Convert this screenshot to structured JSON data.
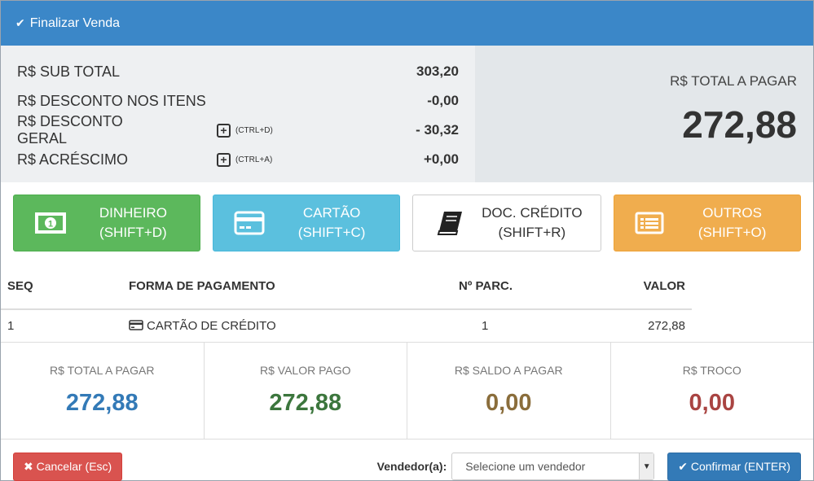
{
  "header": {
    "title": "Finalizar Venda"
  },
  "totals": {
    "rows": [
      {
        "label": "R$ SUB TOTAL",
        "value": "303,20"
      },
      {
        "label": "R$ DESCONTO NOS ITENS",
        "value": "-0,00"
      },
      {
        "label": "R$ DESCONTO GERAL",
        "shortcut": "(CTRL+D)",
        "value": "- 30,32"
      },
      {
        "label": "R$ ACRÉSCIMO",
        "shortcut": "(CTRL+A)",
        "value": "+0,00"
      }
    ],
    "total_label": "R$ TOTAL A PAGAR",
    "total_value": "272,88"
  },
  "payment_buttons": [
    {
      "label": "DINHEIRO",
      "shortcut": "(SHIFT+D)",
      "icon": "money-icon",
      "color": "#5cb85c"
    },
    {
      "label": "CARTÃO",
      "shortcut": "(SHIFT+C)",
      "icon": "credit-card-icon",
      "color": "#5bc0de"
    },
    {
      "label": "DOC. CRÉDITO",
      "shortcut": "(SHIFT+R)",
      "icon": "book-icon",
      "color": "#ffffff"
    },
    {
      "label": "OUTROS",
      "shortcut": "(SHIFT+O)",
      "icon": "list-alt-icon",
      "color": "#f0ad4e"
    }
  ],
  "table": {
    "headers": [
      "SEQ",
      "FORMA DE PAGAMENTO",
      "Nº PARC.",
      "VALOR"
    ],
    "rows": [
      {
        "seq": "1",
        "forma": "CARTÃO DE CRÉDITO",
        "parc": "1",
        "valor": "272,88"
      }
    ]
  },
  "summary": [
    {
      "label": "R$ TOTAL A PAGAR",
      "value": "272,88",
      "color": "#337ab7"
    },
    {
      "label": "R$ VALOR PAGO",
      "value": "272,88",
      "color": "#3c763d"
    },
    {
      "label": "R$ SALDO A PAGAR",
      "value": "0,00",
      "color": "#8a6d3b"
    },
    {
      "label": "R$ TROCO",
      "value": "0,00",
      "color": "#a94442"
    }
  ],
  "footer": {
    "cancel_label": "Cancelar (Esc)",
    "vendor_label": "Vendedor(a):",
    "vendor_select": "Selecione um vendedor",
    "confirm_label": "Confirmar (ENTER)"
  }
}
